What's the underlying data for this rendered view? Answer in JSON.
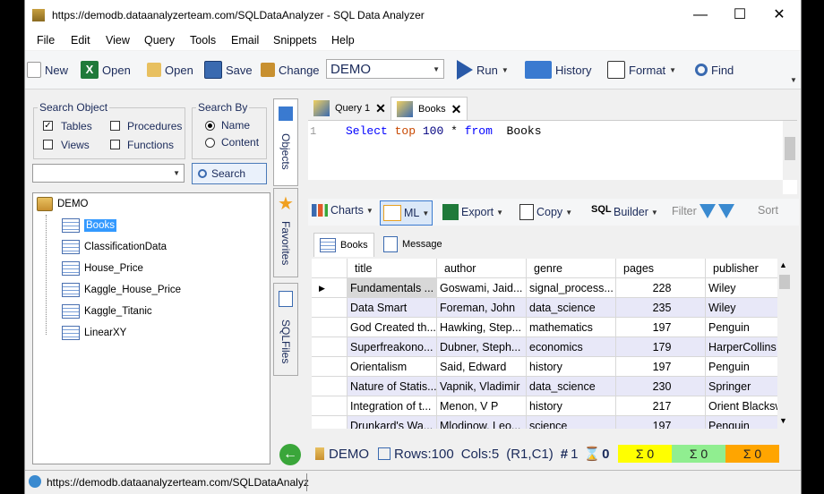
{
  "window": {
    "title": "https://demodb.dataanalyzerteam.com/SQLDataAnalyzer - SQL Data Analyzer"
  },
  "menu": [
    "File",
    "Edit",
    "View",
    "Query",
    "Tools",
    "Email",
    "Snippets",
    "Help"
  ],
  "toolbar": {
    "new": "New",
    "open_excel": "Open",
    "open": "Open",
    "save": "Save",
    "change": "Change",
    "database": "DEMO",
    "run": "Run",
    "history": "History",
    "format": "Format",
    "find": "Find"
  },
  "left": {
    "search_object_label": "Search Object",
    "tables": "Tables",
    "procedures": "Procedures",
    "views": "Views",
    "functions": "Functions",
    "search_by_label": "Search By",
    "name": "Name",
    "content": "Content",
    "search_button": "Search",
    "tree_root": "DEMO",
    "tree_items": [
      "Books",
      "ClassificationData",
      "House_Price",
      "Kaggle_House_Price",
      "Kaggle_Titanic",
      "LinearXY"
    ]
  },
  "vtabs": {
    "objects": "Objects",
    "favorites": "Favorites",
    "sqlfiles": "SQLFiles"
  },
  "editor": {
    "tabs": [
      "Query 1",
      "Books"
    ],
    "line_no": "1",
    "code": {
      "kw1": "Select",
      "kw2": "top",
      "num": "100",
      "star": "*",
      "kw3": "from",
      "ident": "Books"
    }
  },
  "grid_toolbar": {
    "charts": "Charts",
    "ml": "ML",
    "export": "Export",
    "copy": "Copy",
    "builder": "Builder",
    "filter": "Filter",
    "sort": "Sort"
  },
  "result_tabs": [
    "Books",
    "Message"
  ],
  "table": {
    "columns": [
      "title",
      "author",
      "genre",
      "pages",
      "publisher"
    ],
    "rows": [
      [
        "Fundamentals ...",
        "Goswami, Jaid...",
        "signal_process...",
        "228",
        "Wiley"
      ],
      [
        "Data Smart",
        "Foreman, John",
        "data_science",
        "235",
        "Wiley"
      ],
      [
        "God Created th...",
        "Hawking, Step...",
        "mathematics",
        "197",
        "Penguin"
      ],
      [
        "Superfreakono...",
        "Dubner, Steph...",
        "economics",
        "179",
        "HarperCollins"
      ],
      [
        "Orientalism",
        "Said, Edward",
        "history",
        "197",
        "Penguin"
      ],
      [
        "Nature of Statis...",
        "Vapnik, Vladimir",
        "data_science",
        "230",
        "Springer"
      ],
      [
        "Integration of t...",
        "Menon, V P",
        "history",
        "217",
        "Orient Blacksw"
      ],
      [
        "Drunkard's Wa...",
        "Mlodinow, Leo...",
        "science",
        "197",
        "Penguin"
      ]
    ]
  },
  "status": {
    "db": "DEMO",
    "rows": "Rows:100",
    "cols": "Cols:5",
    "pos": "(R1,C1)",
    "sel": "1",
    "zero": "0",
    "sum1": "Σ 0",
    "sum2": "Σ 0",
    "sum3": "Σ 0"
  },
  "colors": {
    "sum1": "#ffff00",
    "sum2": "#90ee90",
    "sum3": "#ffa500",
    "selection": "#3399ff",
    "alt_row": "#e8e8f8"
  },
  "bottom": {
    "url": "https://demodb.dataanalyzerteam.com/SQLDataAnalyz"
  }
}
